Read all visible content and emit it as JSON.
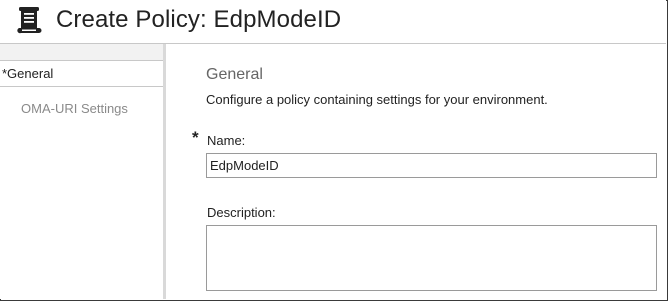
{
  "window": {
    "title": "Create Policy: EdpModeID",
    "icon": "policy-scroll-icon"
  },
  "sidebar": {
    "items": [
      {
        "label": "*General",
        "selected": true
      },
      {
        "label": "OMA-URI Settings",
        "selected": false
      }
    ]
  },
  "main": {
    "section_title": "General",
    "section_description": "Configure a policy containing settings for your environment.",
    "name": {
      "required_marker": "*",
      "label": "Name:",
      "value": "EdpModeID"
    },
    "description": {
      "label": "Description:",
      "value": ""
    }
  },
  "colors": {
    "accent_selected_border": "#c8c8c8",
    "sidebar_separator": "#d9d9d9",
    "muted_text": "#8a8a8a"
  }
}
